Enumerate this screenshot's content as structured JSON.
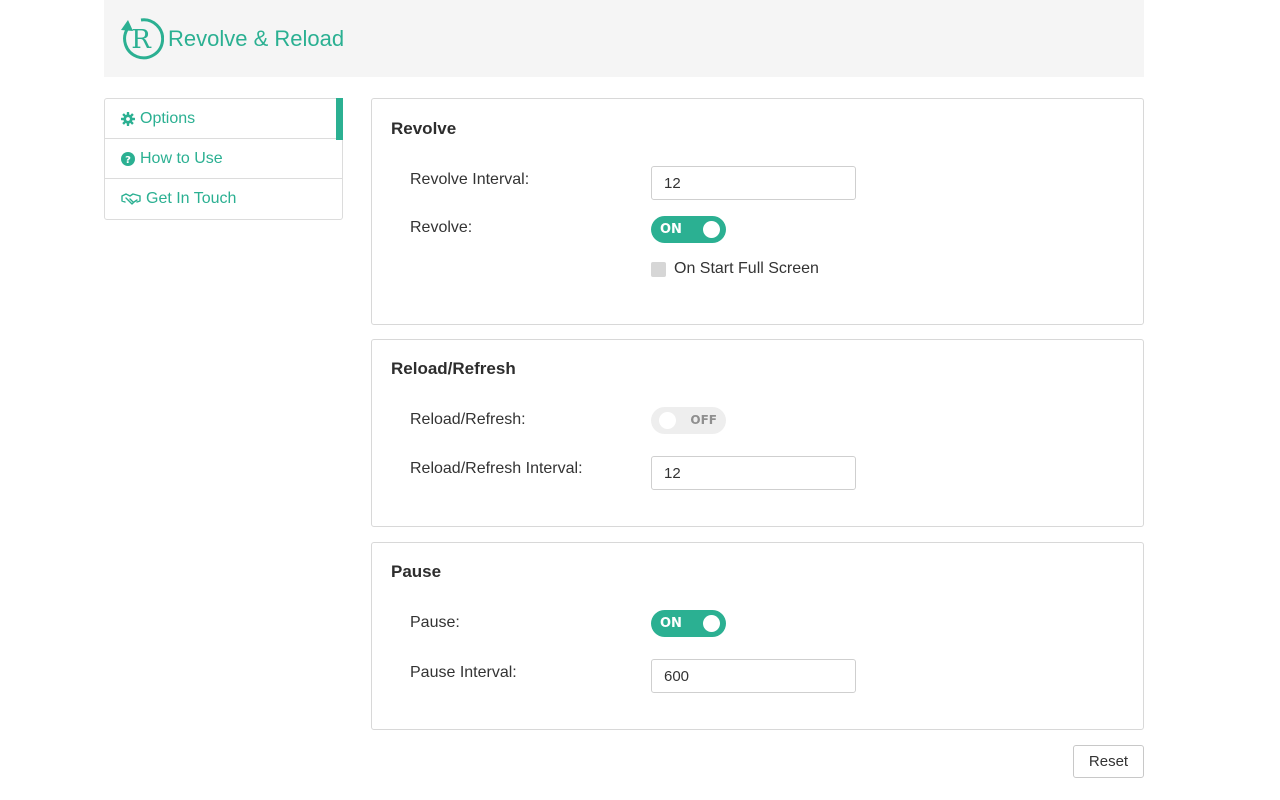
{
  "app": {
    "title": "Revolve & Reload",
    "logo_letter": "R",
    "accent_color": "#2bb092"
  },
  "sidebar": {
    "items": [
      {
        "label": "Options",
        "icon": "gear-icon",
        "active": true
      },
      {
        "label": "How to Use",
        "icon": "question-circle-icon",
        "active": false
      },
      {
        "label": "Get In Touch",
        "icon": "handshake-icon",
        "active": false
      }
    ]
  },
  "revolve": {
    "title": "Revolve",
    "interval_label": "Revolve Interval:",
    "interval_value": "12",
    "toggle_label": "Revolve:",
    "toggle_state": "ON",
    "fullscreen_label": "On Start Full Screen",
    "fullscreen_checked": false
  },
  "reload": {
    "title": "Reload/Refresh",
    "toggle_label": "Reload/Refresh:",
    "toggle_state": "OFF",
    "interval_label": "Reload/Refresh Interval:",
    "interval_value": "12"
  },
  "pause": {
    "title": "Pause",
    "toggle_label": "Pause:",
    "toggle_state": "ON",
    "interval_label": "Pause Interval:",
    "interval_value": "600"
  },
  "actions": {
    "reset_label": "Reset"
  }
}
